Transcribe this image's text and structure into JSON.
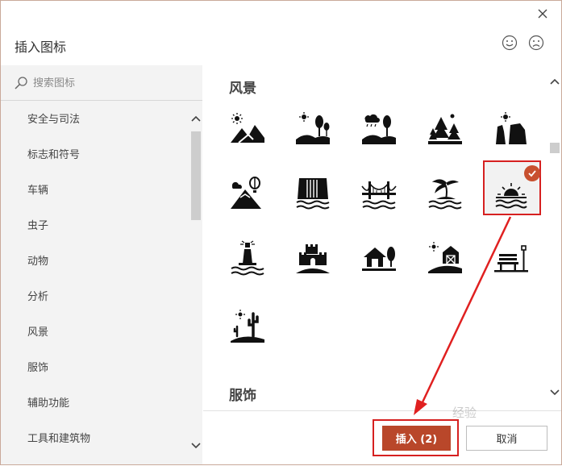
{
  "dialog": {
    "title": "插入图标",
    "close_icon": "close-icon",
    "feedback_icons": [
      "smile-icon",
      "frown-icon"
    ]
  },
  "search": {
    "placeholder": "搜索图标",
    "value": ""
  },
  "sidebar": {
    "categories": [
      {
        "label": "安全与司法"
      },
      {
        "label": "标志和符号"
      },
      {
        "label": "车辆"
      },
      {
        "label": "虫子"
      },
      {
        "label": "动物"
      },
      {
        "label": "分析"
      },
      {
        "label": "风景"
      },
      {
        "label": "服饰"
      },
      {
        "label": "辅助功能"
      },
      {
        "label": "工具和建筑物"
      }
    ]
  },
  "content": {
    "sections": [
      {
        "title": "风景"
      },
      {
        "title": "服饰"
      }
    ],
    "icons": [
      "mountain-sun-icon",
      "hills-trees-sun-icon",
      "hills-trees-rain-icon",
      "pine-trees-sun-icon",
      "mesa-sun-icon",
      "mountain-balloon-icon",
      "waterfall-icon",
      "bridge-icon",
      "island-palm-icon",
      "sunset-water-icon",
      "lighthouse-icon",
      "castle-icon",
      "house-tree-icon",
      "barn-icon",
      "bench-lamp-icon",
      "desert-cactus-icon"
    ],
    "selected_icon": "sunset-water-icon"
  },
  "footer": {
    "insert_label": "插入 (2)",
    "cancel_label": "取消"
  },
  "watermark": {
    "text": "经验"
  },
  "colors": {
    "accent": "#b9472a",
    "highlight": "#d62020",
    "sidebar_bg": "#f3f3f3"
  }
}
